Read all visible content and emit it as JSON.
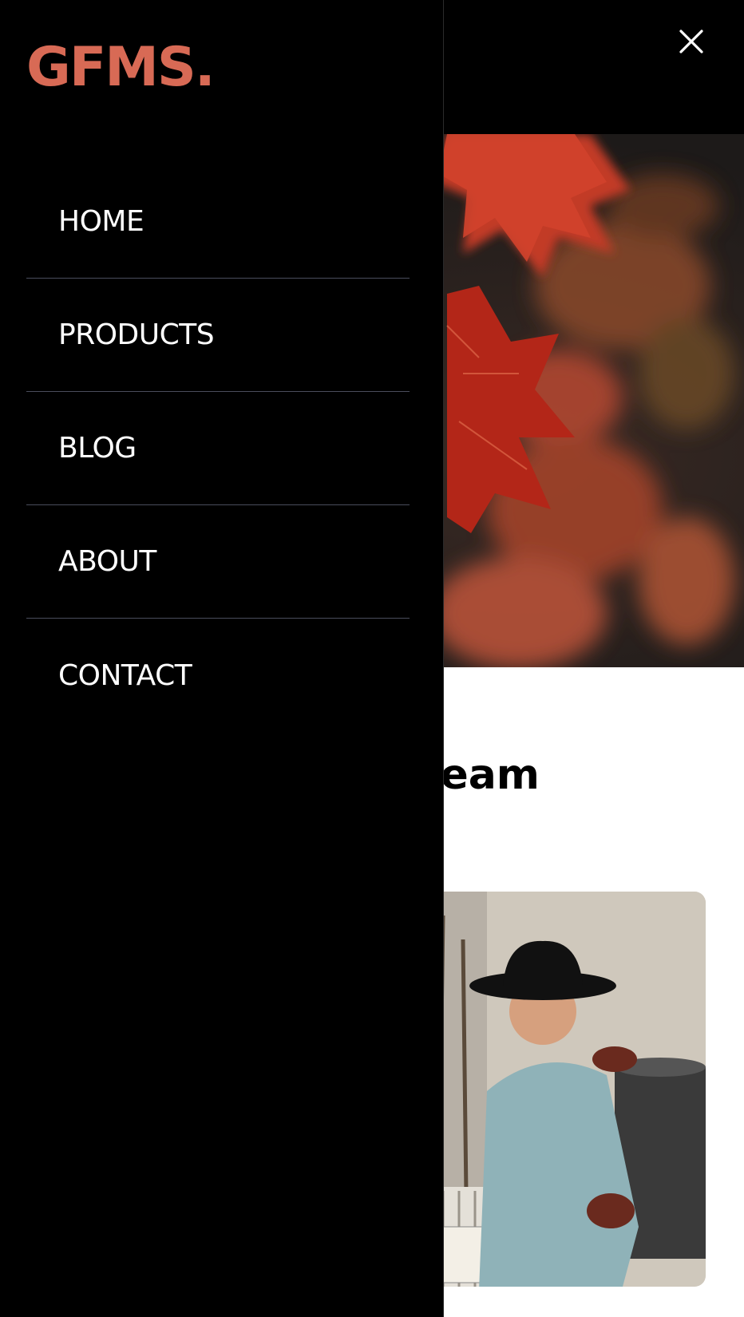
{
  "brand": {
    "logo_text": "GFMS.",
    "logo_color": "#d86a55"
  },
  "drawer": {
    "background": "#000000",
    "divider_color": "#4a4d5c",
    "items": [
      {
        "label": "HOME"
      },
      {
        "label": "PRODUCTS"
      },
      {
        "label": "BLOG"
      },
      {
        "label": "ABOUT"
      },
      {
        "label": "CONTACT"
      }
    ]
  },
  "header": {
    "close_icon": "close-icon"
  },
  "hero": {
    "image": "autumn-maple-leaves"
  },
  "main": {
    "team_heading_visible": "eam",
    "team_photo": "man-in-cowboy-hat-with-filter-press"
  }
}
